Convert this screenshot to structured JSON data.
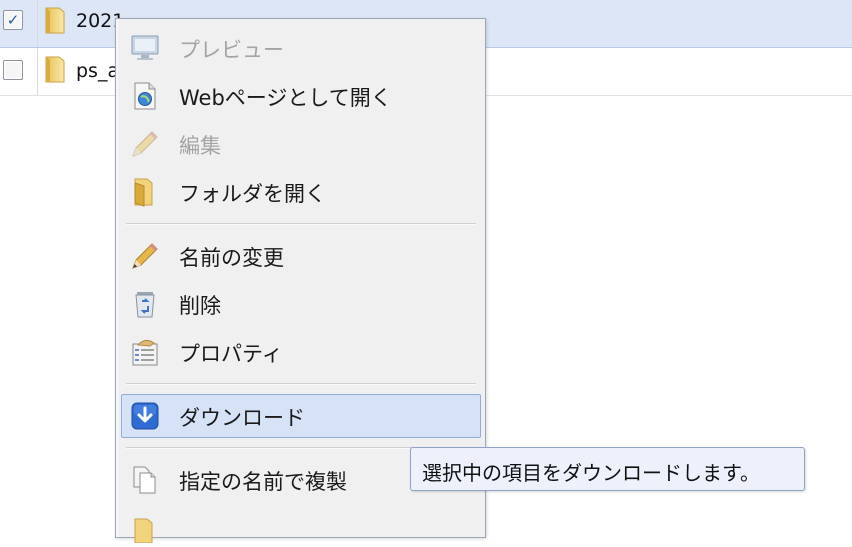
{
  "file_list": {
    "rows": [
      {
        "name": "2021",
        "checked": true,
        "checkmark": "✓",
        "selected": true
      },
      {
        "name": "ps_a",
        "checked": false,
        "checkmark": "",
        "selected": false
      }
    ]
  },
  "context_menu": {
    "items": [
      {
        "label": "プレビュー",
        "icon": "monitor-icon",
        "enabled": false
      },
      {
        "label": "Webページとして開く",
        "icon": "web-page-icon",
        "enabled": true
      },
      {
        "label": "編集",
        "icon": "pencil-icon",
        "enabled": false
      },
      {
        "label": "フォルダを開く",
        "icon": "open-folder-icon",
        "enabled": true
      },
      {
        "label": "名前の変更",
        "icon": "pencil-icon",
        "enabled": true
      },
      {
        "label": "削除",
        "icon": "recycle-icon",
        "enabled": true
      },
      {
        "label": "プロパティ",
        "icon": "properties-icon",
        "enabled": true
      },
      {
        "label": "ダウンロード",
        "icon": "download-icon",
        "enabled": true,
        "highlighted": true
      },
      {
        "label": "指定の名前で複製",
        "icon": "duplicate-icon",
        "enabled": true
      }
    ]
  },
  "tooltip": {
    "text": "選択中の項目をダウンロードします。"
  },
  "colors": {
    "selected_row": "#dde6f6",
    "menu_background": "#f0f0f0",
    "highlight": "#d6e3f7",
    "download_icon": "#2f6bd3"
  }
}
